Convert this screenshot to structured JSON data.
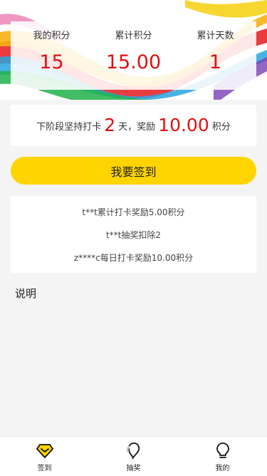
{
  "stats": [
    {
      "label": "我的积分",
      "value": "15"
    },
    {
      "label": "累计积分",
      "value": "15.00"
    },
    {
      "label": "累计天数",
      "value": "1"
    }
  ],
  "streak": {
    "prefix": "下阶段坚持打卡",
    "days": "2",
    "middle": "天，奖励",
    "reward": "10.00",
    "suffix": "积分"
  },
  "checkin_button": "我要签到",
  "feed": [
    "t**t累计打卡奖励5.00积分",
    "t**t抽奖扣除2",
    "z****c每日打卡奖励10.00积分"
  ],
  "explain_title": "说明",
  "tabs": [
    {
      "label": "签到",
      "icon": "diamond-icon"
    },
    {
      "label": "抽奖",
      "icon": "balloon-icon"
    },
    {
      "label": "我的",
      "icon": "lightbulb-icon"
    }
  ],
  "colors": {
    "accent": "#ffd400",
    "highlight": "#e01010",
    "background": "#f4f4f4"
  }
}
